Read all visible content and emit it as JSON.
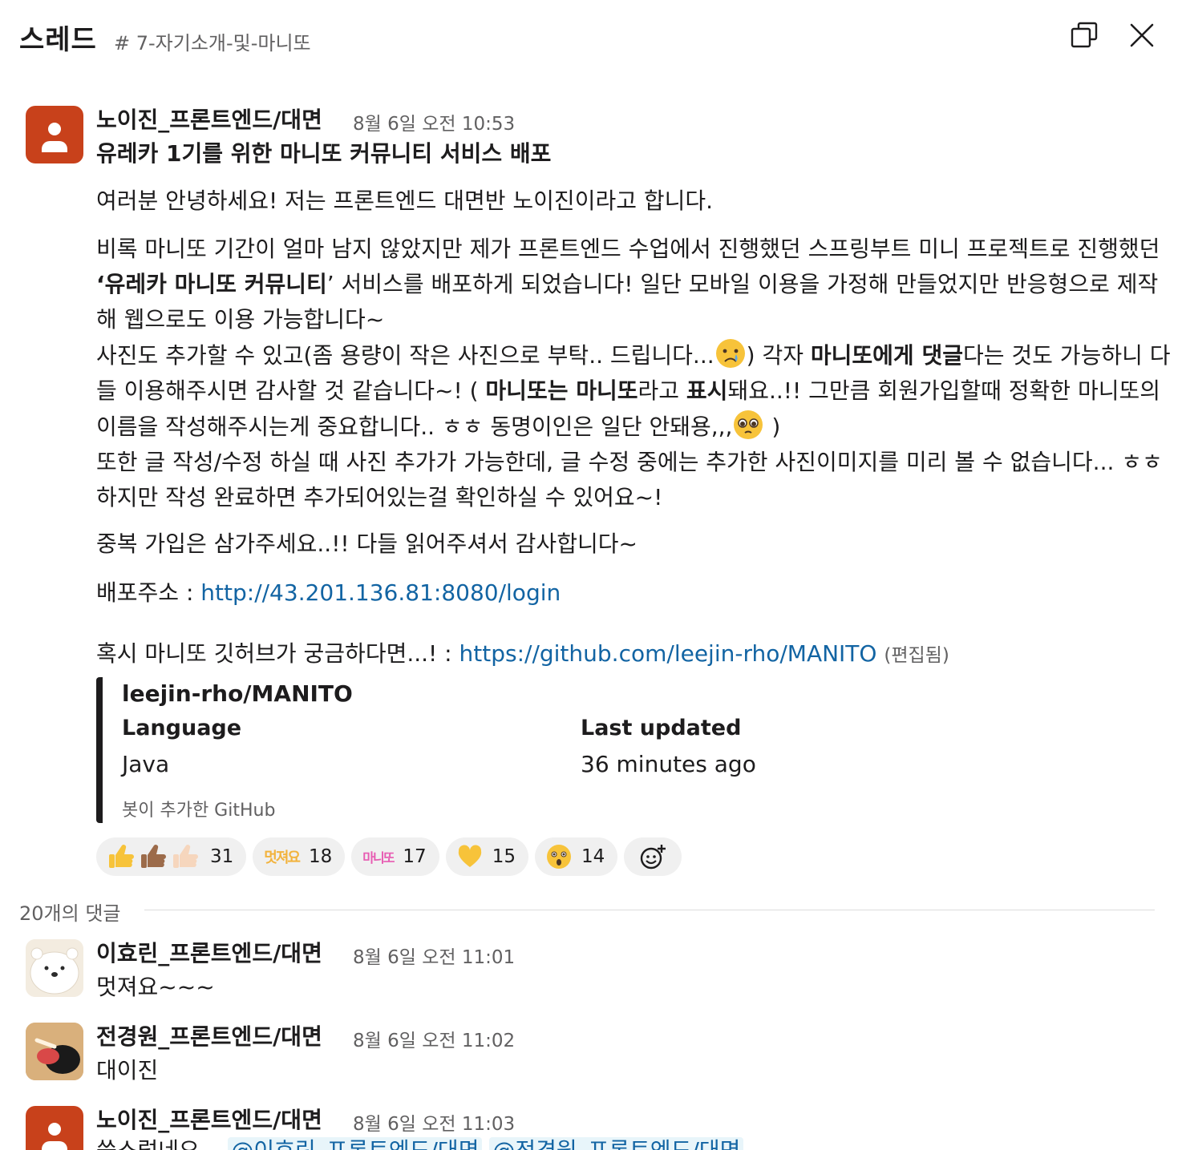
{
  "header": {
    "title": "스레드",
    "channel": "# 7-자기소개-및-마니또",
    "popout_icon": "popout-icon",
    "close_icon": "close-icon"
  },
  "parent": {
    "author": "노이진_프론트엔드/대면",
    "time": "8월 6일 오전 10:53",
    "headline": "유레카 1기를 위한 마니또 커뮤니티 서비스 배포",
    "p1": "여러분 안녕하세요! 저는 프론트엔드 대면반 노이진이라고 합니다.",
    "p2": {
      "a": "비록 마니또 기간이 얼마 남지 않았지만 제가 프론트엔드 수업에서 진행했던 스프링부트 미니 프로젝트로 진행했던 ",
      "b": "‘유레카 마니또 커뮤니티",
      "c": "’ 서비스를 배포하게 되었습니다! 일단 모바일 이용을 가정해 만들었지만 반응형으로 제작해 웹으로도 이용 가능합니다~",
      "d": "사진도 추가할 수 있고(좀 용량이 작은 사진으로 부탁.. 드립니다...",
      "e": ") 각자 ",
      "f": "마니또에게 댓글",
      "g": "다는 것도 가능하니 다들 이용해주시면 감사할 것 같습니다~! ( ",
      "h": "마니또는 마니또",
      "i": "라고 ",
      "j": "표시",
      "k": "돼요..!! 그만큼 회원가입할때 정확한 마니또의 이름을 작성해주시는게 중요합니다.. ㅎㅎ 동명이인은 일단 안돼용,,,",
      "l": " )",
      "m": "또한 글 작성/수정 하실 때 사진 추가가 가능한데, 글 수정 중에는 추가한 사진이미지를 미리 볼 수 없습니다... ㅎㅎ 하지만 작성 완료하면 추가되어있는걸 확인하실 수 있어요~!"
    },
    "p3": "중복 가입은 삼가주세요..!! 다들 읽어주셔서 감사합니다~",
    "deploy_label": "배포주소 : ",
    "deploy_url": "http://43.201.136.81:8080/login",
    "github_label": "혹시 마니또 깃허브가 궁금하다면...! : ",
    "github_url": "https://github.com/leejin-rho/MANITO",
    "edited": "(편집됨)",
    "attachment": {
      "title": "leejin-rho/MANITO",
      "language_label": "Language",
      "language_value": "Java",
      "updated_label": "Last updated",
      "updated_value": "36 minutes ago",
      "footer": "봇이 추가한 GitHub"
    },
    "reactions": [
      {
        "emoji": "thumbs-up-multi",
        "count": "31"
      },
      {
        "emoji": "멋져요",
        "count": "18"
      },
      {
        "emoji": "마니또",
        "count": "17"
      },
      {
        "emoji": "yellow-heart",
        "count": "15"
      },
      {
        "emoji": "astonished-face",
        "count": "14"
      }
    ]
  },
  "divider": "20개의 댓글",
  "replies": [
    {
      "author": "이효린_프론트엔드/대면",
      "time": "8월 6일 오전 11:01",
      "text": "멋져요~~~"
    },
    {
      "author": "전경원_프론트엔드/대면",
      "time": "8월 6일 오전 11:02",
      "text": "대이진"
    },
    {
      "author": "노이진_프론트엔드/대면",
      "time": "8월 6일 오전 11:03",
      "text": "쑥스럽네요...",
      "mention1": "@이효린_프론트엔드/대면",
      "mention2": "@전경원_프론트엔드/대면"
    }
  ],
  "colors": {
    "accent": "#1264a3",
    "avatar_default": "#c8411b",
    "muted": "#616061"
  }
}
